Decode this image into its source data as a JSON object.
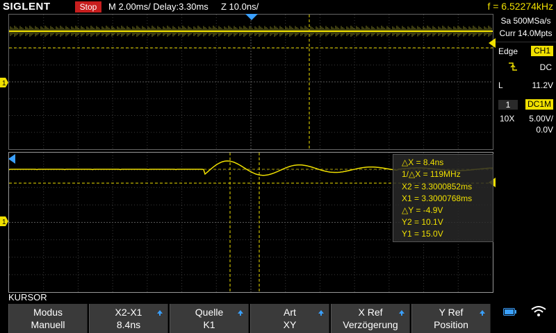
{
  "top_bar": {
    "logo": "SIGLENT",
    "run_state": "Stop",
    "timebase": "M 2.00ms/ Delay:3.30ms",
    "zoom_timebase": "Z 10.0ns/",
    "frequency": "f = 6.52274kHz"
  },
  "acquisition": {
    "sample_rate": "Sa 500MSa/s",
    "memory_depth": "Curr 14.0Mpts"
  },
  "trigger": {
    "type": "Edge",
    "source": "CH1",
    "slope_icon": "rising-edge-icon",
    "coupling": "DC",
    "level_label": "L",
    "level": "11.2V"
  },
  "channel1": {
    "number": "1",
    "coupling": "DC1M",
    "probe": "10X",
    "scale": "5.00V/",
    "offset": "0.0V",
    "marker": "1",
    "color": "#f0e000"
  },
  "cursor_readout": {
    "delta_x": "△X = 8.4ns",
    "inv_delta_x": "1/△X = 119MHz",
    "x2": "X2 = 3.3000852ms",
    "x1": "X1 = 3.3000768ms",
    "delta_y": "△Y = -4.9V",
    "y2": "Y2 = 10.1V",
    "y1": "Y1 = 15.0V"
  },
  "menu": {
    "title": "KURSOR",
    "softkeys": [
      {
        "label": "Modus",
        "value": "Manuell",
        "has_arrow": false
      },
      {
        "label": "X2-X1",
        "value": "8.4ns",
        "has_arrow": true
      },
      {
        "label": "Quelle",
        "value": "K1",
        "has_arrow": true
      },
      {
        "label": "Art",
        "value": "XY",
        "has_arrow": true
      },
      {
        "label": "X Ref",
        "value": "Verzögerung",
        "has_arrow": true
      },
      {
        "label": "Y Ref",
        "value": "Position",
        "has_arrow": true
      }
    ]
  },
  "status_icons": {
    "battery": "battery-icon",
    "wifi": "wifi-icon"
  },
  "colors": {
    "trace": "#f0e000",
    "run_state_bg": "#c81e1e",
    "grid": "#505050",
    "softkey_bg": "#3a3a3a",
    "arrow": "#3aa0ff"
  }
}
